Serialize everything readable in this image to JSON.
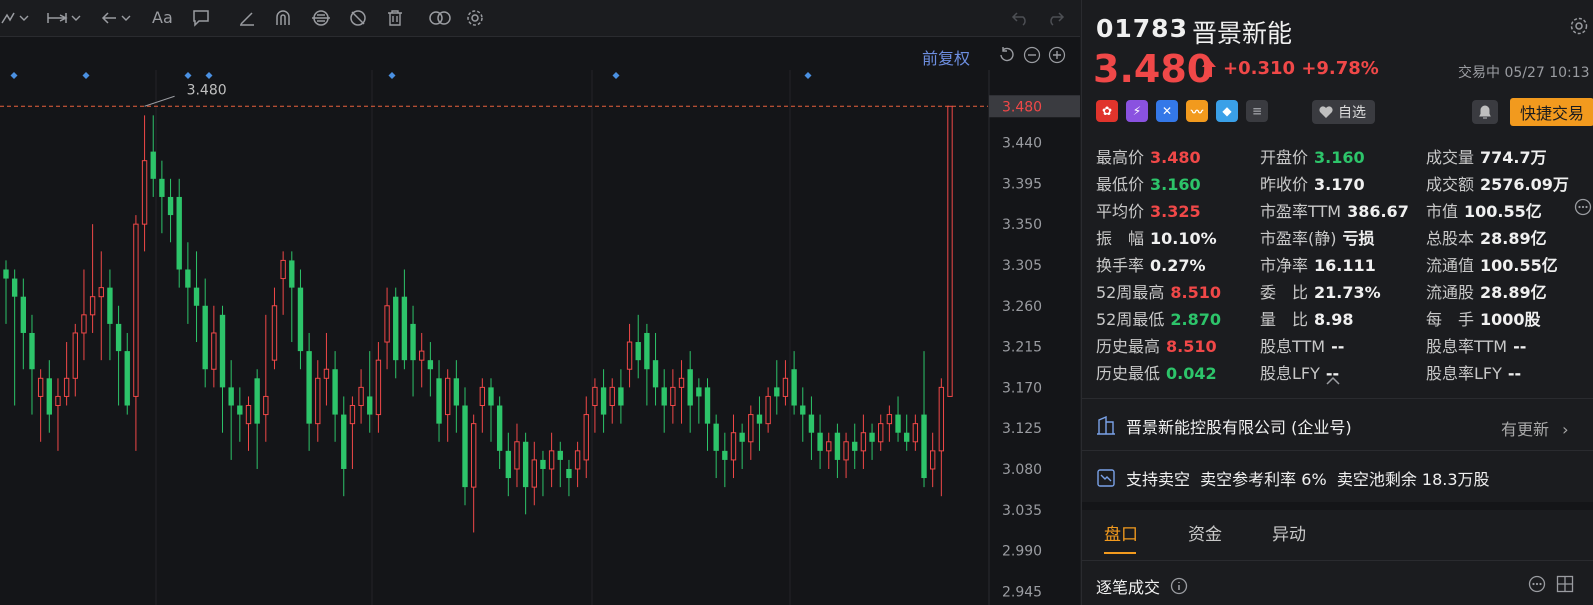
{
  "toolbar": {
    "font_label": "Aa"
  },
  "chart_header": {
    "adjust_label": "前复权"
  },
  "chart_data": {
    "type": "candlestick",
    "title": "",
    "current_price_tag": "3.480",
    "high_marker": "3.480",
    "y_ticks": [
      "3.440",
      "3.395",
      "3.350",
      "3.305",
      "3.260",
      "3.215",
      "3.170",
      "3.125",
      "3.080",
      "3.035",
      "2.990",
      "2.945"
    ],
    "ylim": [
      2.93,
      3.52
    ],
    "colors": {
      "up": "#f04848",
      "down": "#2dc46a",
      "ref_line": "#e8603c",
      "event": "#4a90e2"
    },
    "event_markers": 7,
    "candles": [
      {
        "o": 3.3,
        "c": 3.29,
        "h": 3.31,
        "l": 3.24,
        "s": "d"
      },
      {
        "o": 3.29,
        "c": 3.27,
        "h": 3.3,
        "l": 3.15,
        "s": "d"
      },
      {
        "o": 3.27,
        "c": 3.23,
        "h": 3.29,
        "l": 3.19,
        "s": "d"
      },
      {
        "o": 3.23,
        "c": 3.19,
        "h": 3.25,
        "l": 3.14,
        "s": "d"
      },
      {
        "o": 3.16,
        "c": 3.18,
        "h": 3.19,
        "l": 3.11,
        "s": "u"
      },
      {
        "o": 3.18,
        "c": 3.14,
        "h": 3.2,
        "l": 3.12,
        "s": "d"
      },
      {
        "o": 3.15,
        "c": 3.16,
        "h": 3.18,
        "l": 3.1,
        "s": "u"
      },
      {
        "o": 3.16,
        "c": 3.18,
        "h": 3.22,
        "l": 3.15,
        "s": "u"
      },
      {
        "o": 3.18,
        "c": 3.23,
        "h": 3.24,
        "l": 3.16,
        "s": "u"
      },
      {
        "o": 3.23,
        "c": 3.25,
        "h": 3.3,
        "l": 3.2,
        "s": "u"
      },
      {
        "o": 3.25,
        "c": 3.27,
        "h": 3.35,
        "l": 3.23,
        "s": "u"
      },
      {
        "o": 3.27,
        "c": 3.28,
        "h": 3.32,
        "l": 3.2,
        "s": "u"
      },
      {
        "o": 3.28,
        "c": 3.24,
        "h": 3.3,
        "l": 3.2,
        "s": "d"
      },
      {
        "o": 3.24,
        "c": 3.21,
        "h": 3.26,
        "l": 3.15,
        "s": "d"
      },
      {
        "o": 3.21,
        "c": 3.15,
        "h": 3.23,
        "l": 3.14,
        "s": "d"
      },
      {
        "o": 3.16,
        "c": 3.35,
        "h": 3.36,
        "l": 3.1,
        "s": "u"
      },
      {
        "o": 3.35,
        "c": 3.42,
        "h": 3.47,
        "l": 3.32,
        "s": "u"
      },
      {
        "o": 3.43,
        "c": 3.4,
        "h": 3.47,
        "l": 3.38,
        "s": "d"
      },
      {
        "o": 3.4,
        "c": 3.38,
        "h": 3.42,
        "l": 3.34,
        "s": "d"
      },
      {
        "o": 3.38,
        "c": 3.36,
        "h": 3.4,
        "l": 3.33,
        "s": "d"
      },
      {
        "o": 3.38,
        "c": 3.3,
        "h": 3.4,
        "l": 3.28,
        "s": "d"
      },
      {
        "o": 3.3,
        "c": 3.28,
        "h": 3.33,
        "l": 3.24,
        "s": "d"
      },
      {
        "o": 3.28,
        "c": 3.26,
        "h": 3.32,
        "l": 3.22,
        "s": "d"
      },
      {
        "o": 3.26,
        "c": 3.19,
        "h": 3.29,
        "l": 3.17,
        "s": "d"
      },
      {
        "o": 3.19,
        "c": 3.23,
        "h": 3.26,
        "l": 3.17,
        "s": "u"
      },
      {
        "o": 3.25,
        "c": 3.17,
        "h": 3.26,
        "l": 3.12,
        "s": "d"
      },
      {
        "o": 3.17,
        "c": 3.15,
        "h": 3.2,
        "l": 3.09,
        "s": "d"
      },
      {
        "o": 3.15,
        "c": 3.14,
        "h": 3.17,
        "l": 3.11,
        "s": "d"
      },
      {
        "o": 3.13,
        "c": 3.15,
        "h": 3.16,
        "l": 3.1,
        "s": "u"
      },
      {
        "o": 3.18,
        "c": 3.13,
        "h": 3.19,
        "l": 3.08,
        "s": "d"
      },
      {
        "o": 3.14,
        "c": 3.16,
        "h": 3.25,
        "l": 3.11,
        "s": "u"
      },
      {
        "o": 3.2,
        "c": 3.26,
        "h": 3.28,
        "l": 3.19,
        "s": "u"
      },
      {
        "o": 3.29,
        "c": 3.31,
        "h": 3.32,
        "l": 3.25,
        "s": "u"
      },
      {
        "o": 3.31,
        "c": 3.28,
        "h": 3.32,
        "l": 3.22,
        "s": "d"
      },
      {
        "o": 3.28,
        "c": 3.21,
        "h": 3.3,
        "l": 3.19,
        "s": "d"
      },
      {
        "o": 3.21,
        "c": 3.13,
        "h": 3.23,
        "l": 3.1,
        "s": "d"
      },
      {
        "o": 3.13,
        "c": 3.18,
        "h": 3.2,
        "l": 3.11,
        "s": "u"
      },
      {
        "o": 3.18,
        "c": 3.19,
        "h": 3.23,
        "l": 3.15,
        "s": "u"
      },
      {
        "o": 3.19,
        "c": 3.14,
        "h": 3.21,
        "l": 3.11,
        "s": "d"
      },
      {
        "o": 3.14,
        "c": 3.08,
        "h": 3.16,
        "l": 3.05,
        "s": "d"
      },
      {
        "o": 3.13,
        "c": 3.15,
        "h": 3.16,
        "l": 3.08,
        "s": "u"
      },
      {
        "o": 3.15,
        "c": 3.17,
        "h": 3.19,
        "l": 3.13,
        "s": "u"
      },
      {
        "o": 3.16,
        "c": 3.14,
        "h": 3.21,
        "l": 3.12,
        "s": "d"
      },
      {
        "o": 3.14,
        "c": 3.2,
        "h": 3.22,
        "l": 3.12,
        "s": "u"
      },
      {
        "o": 3.22,
        "c": 3.26,
        "h": 3.28,
        "l": 3.19,
        "s": "u"
      },
      {
        "o": 3.27,
        "c": 3.2,
        "h": 3.28,
        "l": 3.18,
        "s": "d"
      },
      {
        "o": 3.27,
        "c": 3.2,
        "h": 3.3,
        "l": 3.19,
        "s": "d"
      },
      {
        "o": 3.24,
        "c": 3.2,
        "h": 3.26,
        "l": 3.16,
        "s": "d"
      },
      {
        "o": 3.2,
        "c": 3.21,
        "h": 3.23,
        "l": 3.17,
        "s": "u"
      },
      {
        "o": 3.2,
        "c": 3.19,
        "h": 3.22,
        "l": 3.16,
        "s": "d"
      },
      {
        "o": 3.18,
        "c": 3.13,
        "h": 3.2,
        "l": 3.11,
        "s": "d"
      },
      {
        "o": 3.14,
        "c": 3.18,
        "h": 3.19,
        "l": 3.11,
        "s": "u"
      },
      {
        "o": 3.18,
        "c": 3.15,
        "h": 3.2,
        "l": 3.12,
        "s": "d"
      },
      {
        "o": 3.15,
        "c": 3.06,
        "h": 3.17,
        "l": 3.04,
        "s": "d"
      },
      {
        "o": 3.06,
        "c": 3.13,
        "h": 3.14,
        "l": 3.01,
        "s": "u"
      },
      {
        "o": 3.15,
        "c": 3.17,
        "h": 3.18,
        "l": 3.12,
        "s": "u"
      },
      {
        "o": 3.17,
        "c": 3.15,
        "h": 3.18,
        "l": 3.11,
        "s": "d"
      },
      {
        "o": 3.15,
        "c": 3.1,
        "h": 3.16,
        "l": 3.08,
        "s": "d"
      },
      {
        "o": 3.1,
        "c": 3.07,
        "h": 3.12,
        "l": 3.05,
        "s": "d"
      },
      {
        "o": 3.08,
        "c": 3.11,
        "h": 3.13,
        "l": 3.06,
        "s": "u"
      },
      {
        "o": 3.11,
        "c": 3.06,
        "h": 3.12,
        "l": 3.03,
        "s": "d"
      },
      {
        "o": 3.06,
        "c": 3.09,
        "h": 3.11,
        "l": 3.04,
        "s": "u"
      },
      {
        "o": 3.09,
        "c": 3.08,
        "h": 3.1,
        "l": 3.05,
        "s": "d"
      },
      {
        "o": 3.08,
        "c": 3.1,
        "h": 3.12,
        "l": 3.06,
        "s": "u"
      },
      {
        "o": 3.1,
        "c": 3.09,
        "h": 3.11,
        "l": 3.06,
        "s": "d"
      },
      {
        "o": 3.08,
        "c": 3.07,
        "h": 3.09,
        "l": 3.05,
        "s": "d"
      },
      {
        "o": 3.08,
        "c": 3.1,
        "h": 3.11,
        "l": 3.06,
        "s": "u"
      },
      {
        "o": 3.09,
        "c": 3.14,
        "h": 3.16,
        "l": 3.07,
        "s": "u"
      },
      {
        "o": 3.15,
        "c": 3.17,
        "h": 3.18,
        "l": 3.12,
        "s": "u"
      },
      {
        "o": 3.17,
        "c": 3.14,
        "h": 3.19,
        "l": 3.12,
        "s": "d"
      },
      {
        "o": 3.15,
        "c": 3.17,
        "h": 3.18,
        "l": 3.13,
        "s": "u"
      },
      {
        "o": 3.17,
        "c": 3.15,
        "h": 3.19,
        "l": 3.13,
        "s": "d"
      },
      {
        "o": 3.19,
        "c": 3.22,
        "h": 3.24,
        "l": 3.17,
        "s": "u"
      },
      {
        "o": 3.22,
        "c": 3.2,
        "h": 3.25,
        "l": 3.18,
        "s": "d"
      },
      {
        "o": 3.23,
        "c": 3.19,
        "h": 3.24,
        "l": 3.15,
        "s": "d"
      },
      {
        "o": 3.2,
        "c": 3.17,
        "h": 3.23,
        "l": 3.15,
        "s": "d"
      },
      {
        "o": 3.17,
        "c": 3.15,
        "h": 3.19,
        "l": 3.12,
        "s": "d"
      },
      {
        "o": 3.15,
        "c": 3.17,
        "h": 3.19,
        "l": 3.13,
        "s": "u"
      },
      {
        "o": 3.17,
        "c": 3.18,
        "h": 3.2,
        "l": 3.13,
        "s": "u"
      },
      {
        "o": 3.19,
        "c": 3.15,
        "h": 3.21,
        "l": 3.12,
        "s": "d"
      },
      {
        "o": 3.17,
        "c": 3.16,
        "h": 3.18,
        "l": 3.13,
        "s": "d"
      },
      {
        "o": 3.17,
        "c": 3.13,
        "h": 3.18,
        "l": 3.1,
        "s": "d"
      },
      {
        "o": 3.13,
        "c": 3.1,
        "h": 3.14,
        "l": 3.07,
        "s": "d"
      },
      {
        "o": 3.1,
        "c": 3.09,
        "h": 3.12,
        "l": 3.06,
        "s": "d"
      },
      {
        "o": 3.09,
        "c": 3.12,
        "h": 3.14,
        "l": 3.07,
        "s": "u"
      },
      {
        "o": 3.12,
        "c": 3.11,
        "h": 3.13,
        "l": 3.08,
        "s": "d"
      },
      {
        "o": 3.11,
        "c": 3.14,
        "h": 3.15,
        "l": 3.09,
        "s": "u"
      },
      {
        "o": 3.14,
        "c": 3.13,
        "h": 3.16,
        "l": 3.1,
        "s": "d"
      },
      {
        "o": 3.13,
        "c": 3.16,
        "h": 3.17,
        "l": 3.12,
        "s": "u"
      },
      {
        "o": 3.17,
        "c": 3.16,
        "h": 3.2,
        "l": 3.14,
        "s": "d"
      },
      {
        "o": 3.16,
        "c": 3.18,
        "h": 3.2,
        "l": 3.15,
        "s": "u"
      },
      {
        "o": 3.19,
        "c": 3.15,
        "h": 3.21,
        "l": 3.14,
        "s": "d"
      },
      {
        "o": 3.15,
        "c": 3.14,
        "h": 3.17,
        "l": 3.11,
        "s": "d"
      },
      {
        "o": 3.14,
        "c": 3.12,
        "h": 3.16,
        "l": 3.09,
        "s": "d"
      },
      {
        "o": 3.12,
        "c": 3.1,
        "h": 3.14,
        "l": 3.08,
        "s": "d"
      },
      {
        "o": 3.1,
        "c": 3.11,
        "h": 3.12,
        "l": 3.08,
        "s": "u"
      },
      {
        "o": 3.12,
        "c": 3.09,
        "h": 3.13,
        "l": 3.07,
        "s": "d"
      },
      {
        "o": 3.09,
        "c": 3.11,
        "h": 3.12,
        "l": 3.07,
        "s": "u"
      },
      {
        "o": 3.11,
        "c": 3.1,
        "h": 3.13,
        "l": 3.08,
        "s": "d"
      },
      {
        "o": 3.1,
        "c": 3.12,
        "h": 3.14,
        "l": 3.08,
        "s": "u"
      },
      {
        "o": 3.12,
        "c": 3.11,
        "h": 3.13,
        "l": 3.09,
        "s": "d"
      },
      {
        "o": 3.11,
        "c": 3.13,
        "h": 3.14,
        "l": 3.1,
        "s": "u"
      },
      {
        "o": 3.13,
        "c": 3.14,
        "h": 3.15,
        "l": 3.11,
        "s": "u"
      },
      {
        "o": 3.14,
        "c": 3.12,
        "h": 3.16,
        "l": 3.11,
        "s": "d"
      },
      {
        "o": 3.12,
        "c": 3.11,
        "h": 3.14,
        "l": 3.1,
        "s": "d"
      },
      {
        "o": 3.11,
        "c": 3.13,
        "h": 3.14,
        "l": 3.1,
        "s": "u"
      },
      {
        "o": 3.14,
        "c": 3.07,
        "h": 3.21,
        "l": 3.06,
        "s": "d"
      },
      {
        "o": 3.08,
        "c": 3.1,
        "h": 3.12,
        "l": 3.06,
        "s": "u"
      },
      {
        "o": 3.1,
        "c": 3.17,
        "h": 3.18,
        "l": 3.05,
        "s": "u"
      },
      {
        "o": 3.16,
        "c": 3.48,
        "h": 3.48,
        "l": 3.16,
        "s": "u"
      }
    ]
  },
  "stock": {
    "code": "01783",
    "name": "晋景新能",
    "price": "3.480",
    "change": "+0.310",
    "change_pct": "+9.78%",
    "status": "交易中 05/27 10:13"
  },
  "actions": {
    "watchlist_label": "自选",
    "quick_trade_label": "快捷交易"
  },
  "stats": [
    [
      {
        "label": "最高价",
        "value": "3.480",
        "color": "red"
      },
      {
        "label": "开盘价",
        "value": "3.160",
        "color": "green"
      },
      {
        "label": "成交量",
        "value": "774.7万",
        "color": "white"
      }
    ],
    [
      {
        "label": "最低价",
        "value": "3.160",
        "color": "green"
      },
      {
        "label": "昨收价",
        "value": "3.170",
        "color": "white"
      },
      {
        "label": "成交额",
        "value": "2576.09万",
        "color": "white"
      }
    ],
    [
      {
        "label": "平均价",
        "value": "3.325",
        "color": "red"
      },
      {
        "label": "市盈率TTM",
        "value": "386.67",
        "color": "white"
      },
      {
        "label": "市值",
        "value": "100.55亿",
        "color": "white"
      }
    ],
    [
      {
        "label": "振　幅",
        "value": "10.10%",
        "color": "white"
      },
      {
        "label": "市盈率(静)",
        "value": "亏损",
        "color": "white"
      },
      {
        "label": "总股本",
        "value": "28.89亿",
        "color": "white"
      }
    ],
    [
      {
        "label": "换手率",
        "value": "0.27%",
        "color": "white"
      },
      {
        "label": "市净率",
        "value": "16.111",
        "color": "white"
      },
      {
        "label": "流通值",
        "value": "100.55亿",
        "color": "white"
      }
    ],
    [
      {
        "label": "52周最高",
        "value": "8.510",
        "color": "red"
      },
      {
        "label": "委　比",
        "value": "21.73%",
        "color": "white"
      },
      {
        "label": "流通股",
        "value": "28.89亿",
        "color": "white"
      }
    ],
    [
      {
        "label": "52周最低",
        "value": "2.870",
        "color": "green"
      },
      {
        "label": "量　比",
        "value": "8.98",
        "color": "white"
      },
      {
        "label": "每　手",
        "value": "1000股",
        "color": "white"
      }
    ],
    [
      {
        "label": "历史最高",
        "value": "8.510",
        "color": "red"
      },
      {
        "label": "股息TTM",
        "value": "--",
        "color": "white"
      },
      {
        "label": "股息率TTM",
        "value": "--",
        "color": "white"
      }
    ],
    [
      {
        "label": "历史最低",
        "value": "0.042",
        "color": "green"
      },
      {
        "label": "股息LFY",
        "value": "--",
        "color": "white"
      },
      {
        "label": "股息率LFY",
        "value": "--",
        "color": "white"
      }
    ]
  ],
  "company": {
    "name": "晋景新能控股有限公司 (企业号)",
    "update_label": "有更新"
  },
  "short_info": "支持卖空  卖空参考利率 6%  卖空池剩余 18.3万股",
  "tabs": [
    "盘口",
    "资金",
    "异动"
  ],
  "trades_label": "逐笔成交"
}
